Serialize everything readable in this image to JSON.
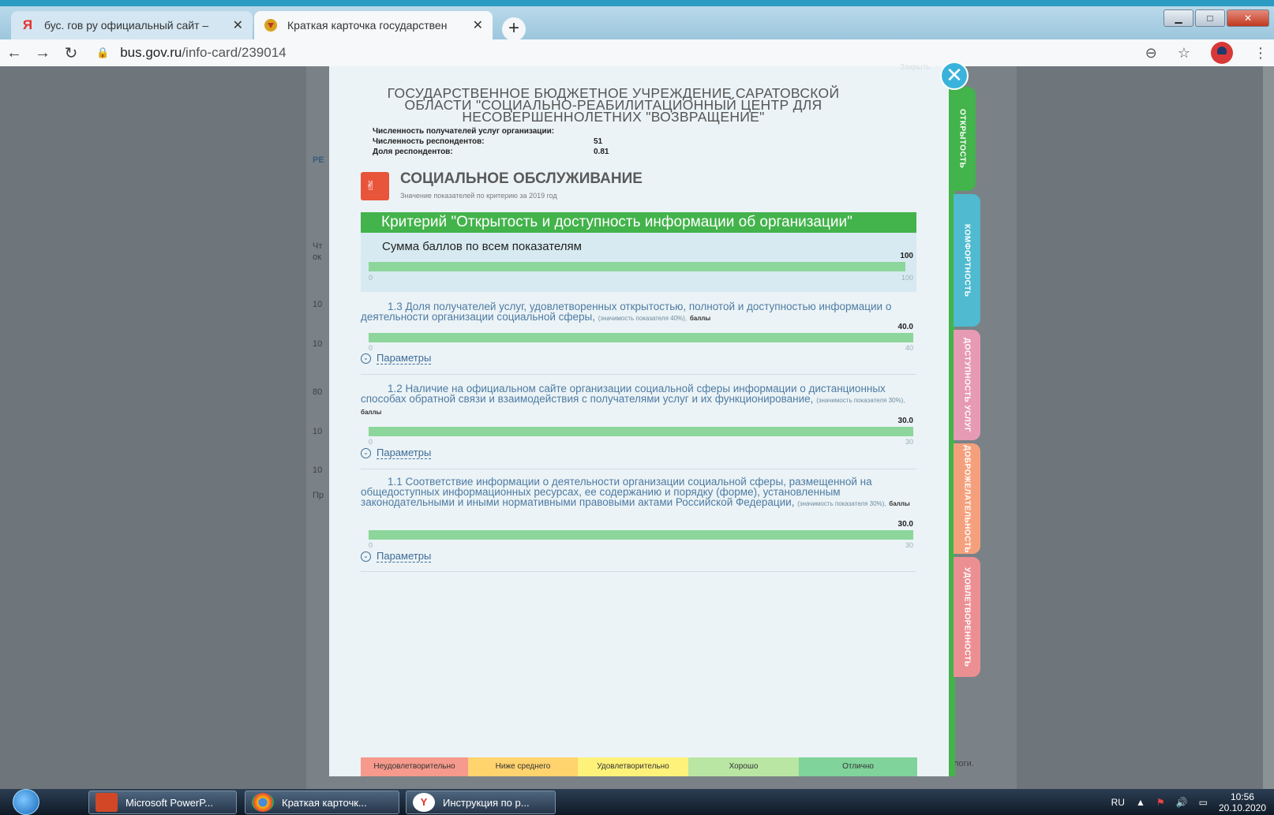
{
  "browser": {
    "tabs": [
      {
        "label": "бус. гов ру официальный сайт –",
        "favicon": "Я"
      },
      {
        "label": "Краткая карточка государствен",
        "favicon": "emblem"
      }
    ],
    "new_tab": "+",
    "url_host": "bus.gov.ru",
    "url_path": "/info-card/239014"
  },
  "modal": {
    "close_label": "Закрыть",
    "org_title": "ГОСУДАРСТВЕННОЕ БЮДЖЕТНОЕ УЧРЕЖДЕНИЕ САРАТОВСКОЙ ОБЛАСТИ \"СОЦИАЛЬНО-РЕАБИЛИТАЦИОННЫЙ ЦЕНТР ДЛЯ НЕСОВЕРШЕННОЛЕТНИХ \"ВОЗВРАЩЕНИЕ\"",
    "stats": [
      {
        "label": "Численность получателей услуг организации:",
        "value": ""
      },
      {
        "label": "Численность респондентов:",
        "value": "51"
      },
      {
        "label": "Доля респондентов:",
        "value": "0.81"
      }
    ],
    "section": {
      "title": "СОЦИАЛЬНОЕ ОБСЛУЖИВАНИЕ",
      "subtitle": "Значение показателей по критерию за 2019 год"
    },
    "criterion": "Критерий \"Открытость и доступность информации об организации\"",
    "sum": {
      "label": "Сумма баллов по всем показателям",
      "value": "100",
      "min": "0",
      "max": "100",
      "fill": 1.0
    },
    "metrics": [
      {
        "text": "1.3 Доля получателей услуг, удовлетворенных открытостью, полнотой и доступностью информации о деятельности организации социальной сферы,",
        "weight": "(значимость показателя 40%),",
        "unit": "баллы",
        "value": "40.0",
        "min": "0",
        "max": "40",
        "fill": 1.0,
        "params": "Параметры"
      },
      {
        "text": "1.2 Наличие на официальном сайте организации социальной сферы информации о дистанционных способах обратной связи и взаимодействия с получателями услуг и их функционирование,",
        "weight": "(значимость показателя 30%),",
        "unit": "баллы",
        "value": "30.0",
        "min": "0",
        "max": "30",
        "fill": 1.0,
        "params": "Параметры"
      },
      {
        "text": "1.1 Соответствие информации о деятельности организации социальной сферы, размещенной на общедоступных информационных ресурсах, ее содержанию и порядку (форме), установленным законодательными и иными нормативными правовыми актами Российской Федерации,",
        "weight": "(значимость показателя 30%),",
        "unit": "баллы",
        "value": "30.0",
        "min": "0",
        "max": "30",
        "fill": 1.0,
        "params": "Параметры"
      }
    ],
    "legend": [
      {
        "label": "Неудовлетворительно",
        "color": "#f59a8c"
      },
      {
        "label": "Ниже среднего",
        "color": "#ffd36e"
      },
      {
        "label": "Удовлетворительно",
        "color": "#fff27a"
      },
      {
        "label": "Хорошо",
        "color": "#b9e6a3"
      },
      {
        "label": "Отлично",
        "color": "#7fd39b"
      }
    ],
    "side_tabs": [
      {
        "label": "ОТКРЫТОСТЬ",
        "color": "#43b34b"
      },
      {
        "label": "КОМФОРТНОСТЬ",
        "color": "#4fbad0"
      },
      {
        "label": "ДОСТУПНОСТЬ УСЛУГ",
        "color": "#e79ab4"
      },
      {
        "label": "ДОБРОЖЕЛАТЕЛЬНОСТЬ",
        "color": "#f5a07d"
      },
      {
        "label": "УДОВЛЕТВОРЕННОСТЬ",
        "color": "#ec8f93"
      }
    ]
  },
  "page_behind": {
    "fragments": [
      "РЕ",
      "Чт",
      "ок",
      "10",
      "10",
      "80",
      "10",
      "10",
      "Пр",
      "логи."
    ]
  },
  "taskbar": {
    "items": [
      {
        "label": "Microsoft PowerP..."
      },
      {
        "label": "Краткая карточк..."
      },
      {
        "label": "Инструкция по р..."
      }
    ],
    "lang": "RU",
    "time": "10:56",
    "date": "20.10.2020"
  }
}
